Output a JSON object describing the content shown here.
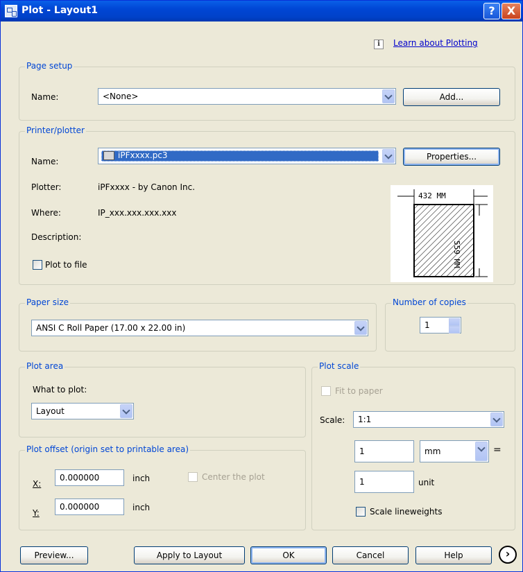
{
  "window": {
    "title": "Plot - Layout1",
    "help_glyph": "?",
    "close_glyph": "X"
  },
  "learn_link": "Learn about Plotting",
  "page_setup": {
    "legend": "Page setup",
    "name_label": "Name:",
    "name_value": "<None>",
    "add_button": "Add..."
  },
  "printer": {
    "legend": "Printer/plotter",
    "name_label": "Name:",
    "name_value": "iPFxxxx.pc3",
    "properties_button": "Properties...",
    "plotter_label": "Plotter:",
    "plotter_value": "iPFxxxx - by Canon Inc.",
    "where_label": "Where:",
    "where_value": "IP_xxx.xxx.xxx.xxx",
    "description_label": "Description:",
    "plot_to_file": "Plot to file",
    "preview_width": "432  MM",
    "preview_height": "559  MM"
  },
  "paper_size": {
    "legend": "Paper size",
    "value": "ANSI C Roll Paper (17.00 x 22.00 in)"
  },
  "copies": {
    "legend": "Number of copies",
    "value": "1"
  },
  "plot_area": {
    "legend": "Plot area",
    "what_label": "What to plot:",
    "what_value": "Layout"
  },
  "plot_offset": {
    "legend": "Plot offset (origin set to printable area)",
    "x_label": "X:",
    "x_value": "0.000000",
    "x_unit": "inch",
    "y_label": "Y:",
    "y_value": "0.000000",
    "y_unit": "inch",
    "center": "Center the plot"
  },
  "plot_scale": {
    "legend": "Plot scale",
    "fit": "Fit to paper",
    "scale_label": "Scale:",
    "scale_value": "1:1",
    "mm_value": "1",
    "mm_unit": "mm",
    "equals": "=",
    "unit_value": "1",
    "unit_label": "unit",
    "lineweights": "Scale lineweights"
  },
  "buttons": {
    "preview": "Preview...",
    "apply": "Apply to Layout",
    "ok": "OK",
    "cancel": "Cancel",
    "help": "Help",
    "more": "›"
  }
}
